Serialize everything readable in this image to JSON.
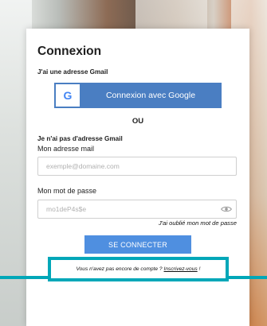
{
  "login": {
    "title": "Connexion",
    "gmail_heading": "J'ai une adresse Gmail",
    "google_button_label": "Connexion avec Google",
    "google_icon_letter": "G",
    "separator": "OU",
    "no_gmail_heading": "Je n'ai pas d'adresse Gmail",
    "email_label": "Mon adresse mail",
    "email_placeholder": "exemple@domaine.com",
    "password_label": "Mon mot de passe",
    "password_placeholder": "mo1deP4s$e",
    "forgot_password": "J'ai oublié mon mot de passe",
    "submit_label": "SE CONNECTER",
    "signup_text": "Vous n'avez pas encore de compte ?",
    "signup_link": "Inscrivez-vous",
    "signup_tail": "!"
  },
  "icons": {
    "google": "google-g-icon",
    "eye": "eye-icon"
  },
  "colors": {
    "google_button": "#4a7ec2",
    "submit_button": "#4f8fe0",
    "highlight": "#00a7b8"
  }
}
